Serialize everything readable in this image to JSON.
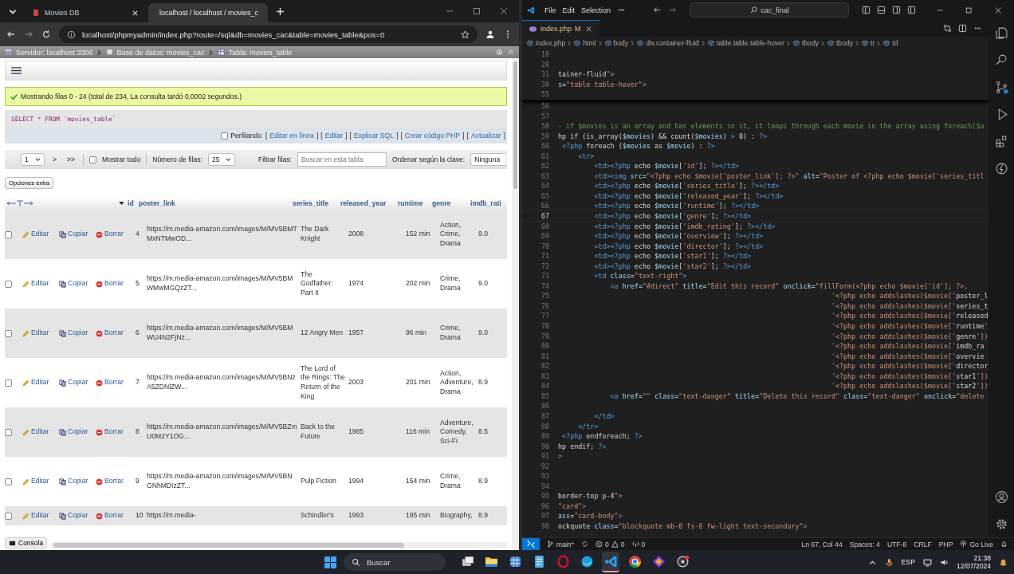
{
  "browser": {
    "tabs": [
      {
        "title": "Movies DB",
        "selected": false
      },
      {
        "title": "localhost / localhost / movies_c",
        "selected": true
      }
    ],
    "url": "localhost/phpmyadmin/index.php?route=/sql&db=movies_cac&table=movies_table&pos=0"
  },
  "pma": {
    "breadcrumb": [
      {
        "kind": "server",
        "label": "Servidor: localhost:3306"
      },
      {
        "kind": "database",
        "label": "Base de datos: movies_cac"
      },
      {
        "kind": "table",
        "label": "Tabla: movies_table"
      }
    ],
    "message": "Mostrando filas 0 - 24 (total de 234, La consulta tardó 0,0002 segundos.)",
    "sql": "SELECT * FROM `movies_table`",
    "profiling": {
      "label": "Perfilando",
      "checked": false,
      "links": [
        {
          "open": "[",
          "label": "Editar en línea",
          "close": "]"
        },
        {
          "open": "[",
          "label": "Editar",
          "close": "]"
        },
        {
          "open": "[",
          "label": "Explicar SQL",
          "close": "]"
        },
        {
          "open": "[",
          "label": "Crear código PHP",
          "close": "]"
        },
        {
          "open": "[",
          "label": "Actualizar",
          "close": "]"
        }
      ]
    },
    "nav": {
      "page": "1",
      "next": ">",
      "last": ">>",
      "show_all": {
        "label": "Mostrar todo",
        "checked": false
      },
      "rows_label": "Número de filas:",
      "rows_value": "25",
      "filter_label": "Filtrar filas:",
      "filter_placeholder": "Buscar en esta tabla",
      "sort_label": "Ordenar según la clave:",
      "sort_value": "Ninguna"
    },
    "extra_options": "Opciones extra",
    "columns": [
      "id",
      "poster_link",
      "series_title",
      "released_year",
      "runtime",
      "genre",
      "imdb_rati"
    ],
    "rows": [
      {
        "checked": false,
        "edit": "Editar",
        "copy": "Copiar",
        "delete": "Borrar",
        "id": "4",
        "poster": "https://m.media-amazon.com/images/M/MV5BMTMxNTMwOD...",
        "title": "The Dark Knight",
        "year": "2008",
        "runtime": "152 min",
        "genre": "Action, Crime, Drama",
        "rating": "9.0"
      },
      {
        "checked": false,
        "edit": "Editar",
        "copy": "Copiar",
        "delete": "Borrar",
        "id": "5",
        "poster": "https://m.media-amazon.com/images/M/MV5BMWMwMGQzZT...",
        "title": "The Godfather: Part II",
        "year": "1974",
        "runtime": "202 min",
        "genre": "Crime, Drama",
        "rating": "9.0"
      },
      {
        "checked": false,
        "edit": "Editar",
        "copy": "Copiar",
        "delete": "Borrar",
        "id": "6",
        "poster": "https://m.media-amazon.com/images/M/MV5BMWU4N2FjNz...",
        "title": "12 Angry Men",
        "year": "1957",
        "runtime": "96 min",
        "genre": "Crime, Drama",
        "rating": "9.0"
      },
      {
        "checked": false,
        "edit": "Editar",
        "copy": "Copiar",
        "delete": "Borrar",
        "id": "7",
        "poster": "https://m.media-amazon.com/images/M/MV5BNzA5ZDNlZW...",
        "title": "The Lord of the Rings: The Return of the King",
        "year": "2003",
        "runtime": "201 min",
        "genre": "Action, Adventure, Drama",
        "rating": "8.9"
      },
      {
        "checked": false,
        "edit": "Editar",
        "copy": "Copiar",
        "delete": "Borrar",
        "id": "8",
        "poster": "https://m.media-amazon.com/images/M/MV5BZmU0M2Y1OG...",
        "title": "Back to the Future",
        "year": "1985",
        "runtime": "116 min",
        "genre": "Adventure, Comedy, Sci-Fi",
        "rating": "8.5"
      },
      {
        "checked": false,
        "edit": "Editar",
        "copy": "Copiar",
        "delete": "Borrar",
        "id": "9",
        "poster": "https://m.media-amazon.com/images/M/MV5BNGNhMDIzZT...",
        "title": "Pulp Fiction",
        "year": "1994",
        "runtime": "154 min",
        "genre": "Crime, Drama",
        "rating": "8.9"
      },
      {
        "checked": false,
        "edit": "Editar",
        "copy": "Copiar",
        "delete": "Borrar",
        "id": "10",
        "poster": "https://m.media-",
        "title": "Schindler's",
        "year": "1993",
        "runtime": "195 min",
        "genre": "Biography,",
        "rating": "8.9"
      }
    ],
    "console": "Consola"
  },
  "editor": {
    "menu": [
      "File",
      "Edit",
      "Selection"
    ],
    "search": "cac_final",
    "tab": {
      "name": "index.php",
      "status": "M"
    },
    "breadcrumb": [
      "index.php",
      "html",
      "body",
      "div.container-fluid",
      "table.table.table-hover",
      "tbody",
      "tbody",
      "tr",
      "td"
    ],
    "sticky_lines": [
      {
        "num": "18"
      },
      {
        "num": "28"
      },
      {
        "num": "31",
        "kind": "code",
        "text": "tainer-fluid\">"
      },
      {
        "num": "38",
        "kind": "code",
        "text": "s=\"table table-hover\">"
      },
      {
        "num": "55"
      }
    ],
    "lines": [
      {
        "num": "56",
        "current": false
      },
      {
        "num": "57",
        "current": false
      },
      {
        "num": "58",
        "current": false,
        "kind": "comment",
        "text": "- if $movies is an array and has elements in it, it loops through each movie in the array using foreach($a"
      },
      {
        "num": "59",
        "current": false,
        "kind": "code",
        "text": "hp if (is_array($movies) && count($movies) > 0) : ?>"
      },
      {
        "num": "60",
        "current": false,
        "kind": "code",
        "text": " <?php foreach ($movies as $movie) : ?>"
      },
      {
        "num": "61",
        "current": false,
        "kind": "code",
        "text": "     <tr>"
      },
      {
        "num": "62",
        "current": false,
        "kind": "code",
        "text": "         <td><?php echo $movie['id']; ?></td>"
      },
      {
        "num": "63",
        "current": false,
        "kind": "code",
        "text": "         <td><img src=\"<?php echo $movie['poster_link']; ?>\" alt=\"Poster of <?php echo $movie['series_titl"
      },
      {
        "num": "64",
        "current": false,
        "kind": "code",
        "text": "         <td><?php echo $movie['series_title']; ?></td>"
      },
      {
        "num": "65",
        "current": false,
        "kind": "code",
        "text": "         <td><?php echo $movie['released_year']; ?></td>"
      },
      {
        "num": "66",
        "current": false,
        "kind": "code",
        "text": "         <td><?php echo $movie['runtime']; ?></td>"
      },
      {
        "num": "67",
        "current": true,
        "kind": "code",
        "text": "         <td><?php echo $movie['genre']; ?></td>"
      },
      {
        "num": "68",
        "current": false,
        "kind": "code",
        "text": "         <td><?php echo $movie['imdb_rating']; ?></td>"
      },
      {
        "num": "69",
        "current": false,
        "kind": "code",
        "text": "         <td><?php echo $movie['overview']; ?></td>"
      },
      {
        "num": "70",
        "current": false,
        "kind": "code",
        "text": "         <td><?php echo $movie['director']; ?></td>"
      },
      {
        "num": "71",
        "current": false,
        "kind": "code",
        "text": "         <td><?php echo $movie['star1']; ?></td>"
      },
      {
        "num": "72",
        "current": false,
        "kind": "code",
        "text": "         <td><?php echo $movie['star2']; ?></td>"
      },
      {
        "num": "73",
        "current": false,
        "kind": "code",
        "text": "         <td class=\"text-right\">"
      },
      {
        "num": "74",
        "current": false,
        "kind": "code",
        "text": "             <a href=\"#direct\" title=\"Edit this record\" onclick=\"fillForm(<?php echo $movie['id']; ?>,"
      },
      {
        "num": "75",
        "current": false,
        "kind": "code",
        "text": "                                                                    '<?php echo addslashes($movie['poster_l"
      },
      {
        "num": "76",
        "current": false,
        "kind": "code",
        "text": "                                                                    '<?php echo addslashes($movie['series_t"
      },
      {
        "num": "77",
        "current": false,
        "kind": "code",
        "text": "                                                                    '<?php echo addslashes($movie['released"
      },
      {
        "num": "78",
        "current": false,
        "kind": "code",
        "text": "                                                                    '<?php echo addslashes($movie['runtime'"
      },
      {
        "num": "79",
        "current": false,
        "kind": "code",
        "text": "                                                                    '<?php echo addslashes($movie['genre'])"
      },
      {
        "num": "80",
        "current": false,
        "kind": "code",
        "text": "                                                                    '<?php echo addslashes($movie['imdb_ra"
      },
      {
        "num": "81",
        "current": false,
        "kind": "code",
        "text": "                                                                    '<?php echo addslashes($movie['overvie"
      },
      {
        "num": "82",
        "current": false,
        "kind": "code",
        "text": "                                                                    '<?php echo addslashes($movie['director"
      },
      {
        "num": "83",
        "current": false,
        "kind": "code",
        "text": "                                                                    '<?php echo addslashes($movie['star1'])"
      },
      {
        "num": "84",
        "current": false,
        "kind": "code",
        "text": "                                                                    '<?php echo addslashes($movie['star2'])"
      },
      {
        "num": "85",
        "current": false,
        "kind": "code",
        "text": "             <a href=\"\" class=\"text-danger\" title=\"Delete this record\" class=\"text-danger\" onclick=\"delete"
      },
      {
        "num": "86",
        "current": false
      },
      {
        "num": "87",
        "current": false,
        "kind": "code",
        "text": "         </td>"
      },
      {
        "num": "88",
        "current": false,
        "kind": "code",
        "text": "     </tr>"
      },
      {
        "num": "89",
        "current": false,
        "kind": "code",
        "text": " <?php endforeach; ?>"
      },
      {
        "num": "90",
        "current": false,
        "kind": "code",
        "text": "hp endif; ?>"
      },
      {
        "num": "91",
        "current": false,
        "kind": "code",
        "text": ">"
      },
      {
        "num": "92",
        "current": false
      },
      {
        "num": "93",
        "current": false
      },
      {
        "num": "94",
        "current": false
      },
      {
        "num": "95",
        "current": false,
        "kind": "code",
        "text": "border-top p-4\">"
      },
      {
        "num": "96",
        "current": false,
        "kind": "code",
        "text": "\"card\">"
      },
      {
        "num": "97",
        "current": false,
        "kind": "code",
        "text": "ass=\"card-body\">"
      },
      {
        "num": "98",
        "current": false,
        "kind": "code",
        "text": "ockquote class=\"blockquote mb-0 fs-6 fw-light text-secondary\">"
      }
    ],
    "status": {
      "branch": "main*",
      "errors": "0",
      "warnings": "0",
      "ports": "0",
      "position": "Ln 67, Col 44",
      "spaces": "Spaces: 4",
      "encoding": "UTF-8",
      "eol": "CRLF",
      "language": "PHP",
      "live": "Go Live"
    }
  },
  "taskbar": {
    "search": "Buscar",
    "apps": [
      {
        "kind": "taskview",
        "selected": false
      },
      {
        "kind": "folder",
        "selected": false
      },
      {
        "kind": "grid",
        "selected": false
      },
      {
        "kind": "notepad",
        "selected": false
      },
      {
        "kind": "ring",
        "selected": false
      },
      {
        "kind": "globe",
        "selected": false
      },
      {
        "kind": "code",
        "selected": true
      },
      {
        "kind": "chrome",
        "selected": false
      },
      {
        "kind": "diamond",
        "selected": false
      },
      {
        "kind": "camera",
        "selected": false
      }
    ],
    "language": "ESP",
    "time": "21:38",
    "date": "12/07/2024"
  }
}
